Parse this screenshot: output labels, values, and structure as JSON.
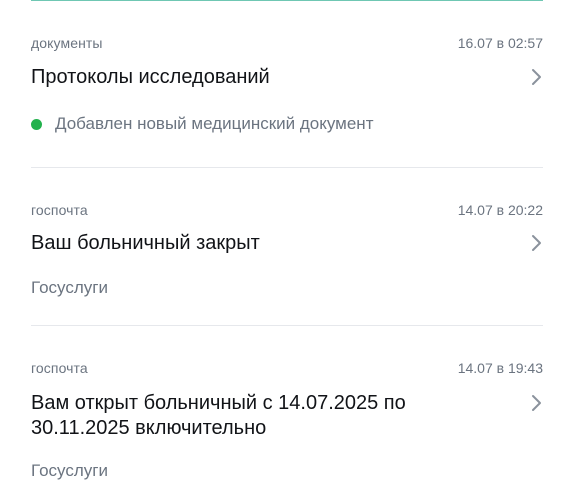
{
  "feed": {
    "items": [
      {
        "category": "документы",
        "timestamp": "16.07 в 02:57",
        "title": "Протоколы исследований",
        "subtitle": "Добавлен новый медицинский документ",
        "status_color": "#22b14c"
      },
      {
        "category": "госпочта",
        "timestamp": "14.07 в 20:22",
        "title": "Ваш больничный закрыт",
        "subtitle": "Госуслуги"
      },
      {
        "category": "госпочта",
        "timestamp": "14.07 в 19:43",
        "title": "Вам открыт больничный с 14.07.2025 по 30.11.2025 включительно",
        "subtitle": "Госуслуги"
      }
    ]
  },
  "icons": {
    "chevron": "chevron-right-icon",
    "status": "status-dot-icon"
  },
  "colors": {
    "accent_divider": "#6fc7b3",
    "status_green": "#22b14c",
    "secondary_text": "#6b7480",
    "primary_text": "#111317"
  }
}
